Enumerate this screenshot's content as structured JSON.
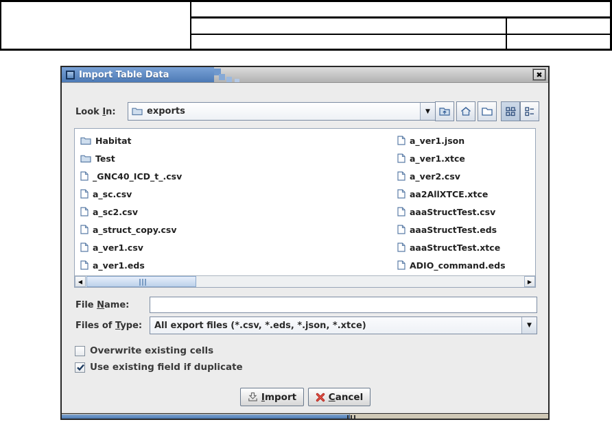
{
  "colors": {
    "title_blue_top": "#7aa2d6",
    "title_blue_bottom": "#4a78b4",
    "dialog_bg": "#ececec",
    "field_border": "#7b8ba2",
    "cancel_red": "#c22e2e",
    "scrollbar_thumb": "#c6d8ee",
    "table_line": "#000000"
  },
  "dialog": {
    "title": "Import Table Data",
    "icons": {
      "close": "✖",
      "dropdown": "▼",
      "scroll_left": "◀",
      "scroll_right": "▶"
    },
    "look_in": {
      "label_pre": "Look ",
      "label_mn": "I",
      "label_post": "n:",
      "value": "exports"
    },
    "toolbar": {
      "buttons": [
        "up-one-level",
        "home",
        "new-folder",
        "details-view",
        "list-view"
      ],
      "selected": "details-view"
    },
    "file_list": {
      "left": [
        {
          "name": "Habitat",
          "type": "folder"
        },
        {
          "name": "Test",
          "type": "folder"
        },
        {
          "name": "_GNC40_ICD_t_.csv",
          "type": "file"
        },
        {
          "name": "a_sc.csv",
          "type": "file"
        },
        {
          "name": "a_sc2.csv",
          "type": "file"
        },
        {
          "name": "a_struct_copy.csv",
          "type": "file"
        },
        {
          "name": "a_ver1.csv",
          "type": "file"
        },
        {
          "name": "a_ver1.eds",
          "type": "file"
        }
      ],
      "right": [
        {
          "name": "a_ver1.json",
          "type": "file"
        },
        {
          "name": "a_ver1.xtce",
          "type": "file"
        },
        {
          "name": "a_ver2.csv",
          "type": "file"
        },
        {
          "name": "aa2AllXTCE.xtce",
          "type": "file"
        },
        {
          "name": "aaaStructTest.csv",
          "type": "file"
        },
        {
          "name": "aaaStructTest.eds",
          "type": "file"
        },
        {
          "name": "aaaStructTest.xtce",
          "type": "file"
        },
        {
          "name": "ADIO_command.eds",
          "type": "file"
        }
      ]
    },
    "file_name": {
      "label_pre": "File ",
      "label_mn": "N",
      "label_post": "ame:",
      "value": ""
    },
    "files_of_type": {
      "label_pre": "Files of ",
      "label_mn": "T",
      "label_post": "ype:",
      "value": "All export files (*.csv, *.eds, *.json, *.xtce)"
    },
    "options": [
      {
        "label": "Overwrite existing cells",
        "checked": false
      },
      {
        "label": "Use existing field if duplicate",
        "checked": true
      }
    ],
    "buttons": {
      "import_mn": "I",
      "import_post": "mport",
      "cancel_mn": "C",
      "cancel_post": "ancel"
    }
  }
}
